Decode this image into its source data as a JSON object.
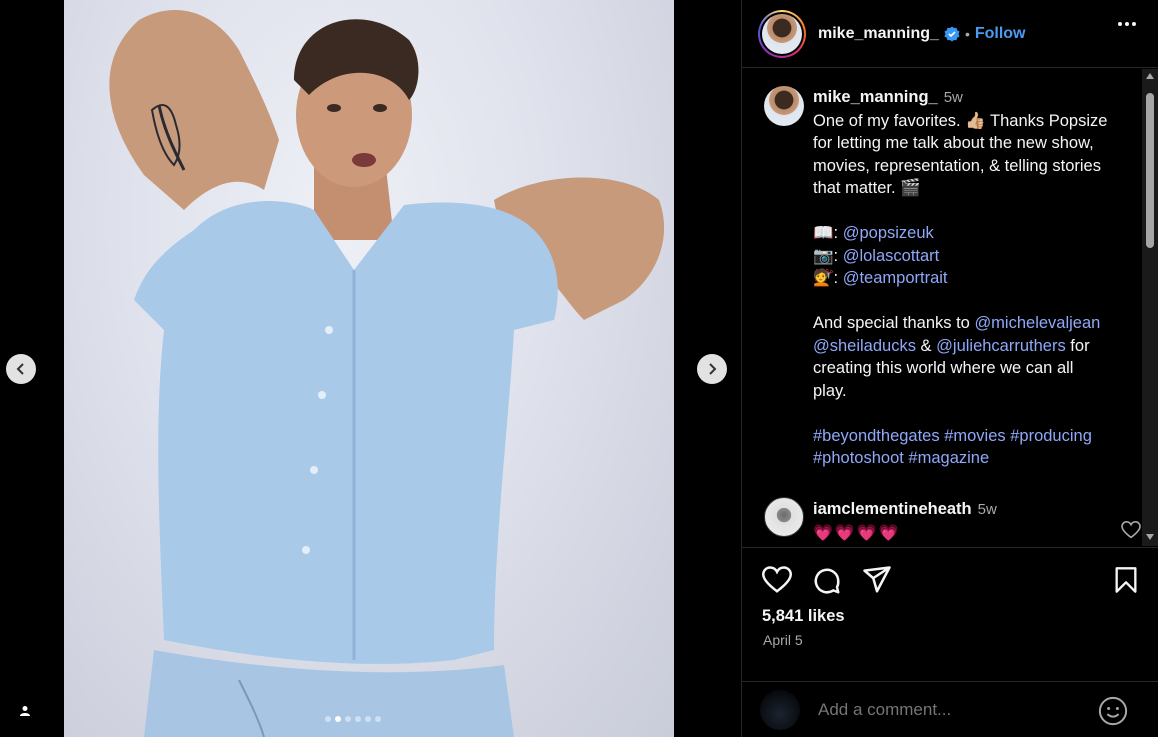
{
  "post": {
    "author": "mike_manning_",
    "follow_label": "Follow",
    "separator": "•",
    "caption": {
      "time": "5w",
      "lines": [
        "One of my favorites. 👍🏼 Thanks Popsize",
        "for letting me talk about the new show,",
        "movies, representation, & telling stories",
        "that matter. 🎬"
      ],
      "credits": [
        {
          "emoji": "📖",
          "handle": "@popsizeuk"
        },
        {
          "emoji": "📷",
          "handle": "@lolascottart"
        },
        {
          "emoji": "💇",
          "handle": "@teamportrait"
        }
      ],
      "thanks_prefix": "And special thanks to ",
      "thanks_handle1": "@michelevaljean",
      "thanks_handle2": "@sheiladucks",
      "thanks_amp": " & ",
      "thanks_handle3": "@juliehcarruthers",
      "thanks_suffix1": " for",
      "thanks_line3": "creating this world where we can all",
      "thanks_line4": "play.",
      "hashtags_line1": "#beyondthegates #movies #producing",
      "hashtags_line2": "#photoshoot #magazine"
    },
    "comments": [
      {
        "user": "iamclementineheath",
        "time": "5w",
        "text": "💗💗💗💗"
      }
    ],
    "likes": "5,841 likes",
    "date": "April 5",
    "add_comment_placeholder": "Add a comment..."
  },
  "carousel": {
    "total": 6,
    "active": 1
  },
  "icons": {
    "prev": "chevron-left-icon",
    "next": "chevron-right-icon",
    "user_tag": "user-icon",
    "more": "more-icon",
    "verified": "verified-badge-icon",
    "like": "heart-icon",
    "comment": "comment-icon",
    "share": "send-icon",
    "save": "bookmark-icon",
    "emoji": "emoji-icon"
  },
  "colors": {
    "link": "#8fa8f8",
    "follow": "#4a9cf0",
    "verified": "#3897f0",
    "hearts": "#ff3b6b"
  }
}
